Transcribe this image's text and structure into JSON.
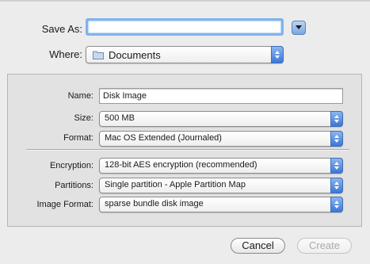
{
  "save_row": {
    "label": "Save As:",
    "value": ""
  },
  "where_row": {
    "label": "Where:",
    "selected": "Documents",
    "icon": "folder-icon"
  },
  "options": {
    "name": {
      "label": "Name:",
      "value": "Disk Image"
    },
    "size": {
      "label": "Size:",
      "selected": "500 MB"
    },
    "format": {
      "label": "Format:",
      "selected": "Mac OS Extended (Journaled)"
    },
    "encryption": {
      "label": "Encryption:",
      "selected": "128-bit AES encryption (recommended)"
    },
    "partitions": {
      "label": "Partitions:",
      "selected": "Single partition - Apple Partition Map"
    },
    "image_format": {
      "label": "Image Format:",
      "selected": "sparse bundle disk image"
    }
  },
  "buttons": {
    "cancel": "Cancel",
    "create": "Create"
  },
  "colors": {
    "accent": "#3b77d6",
    "focus_ring": "#7fb3ec"
  }
}
